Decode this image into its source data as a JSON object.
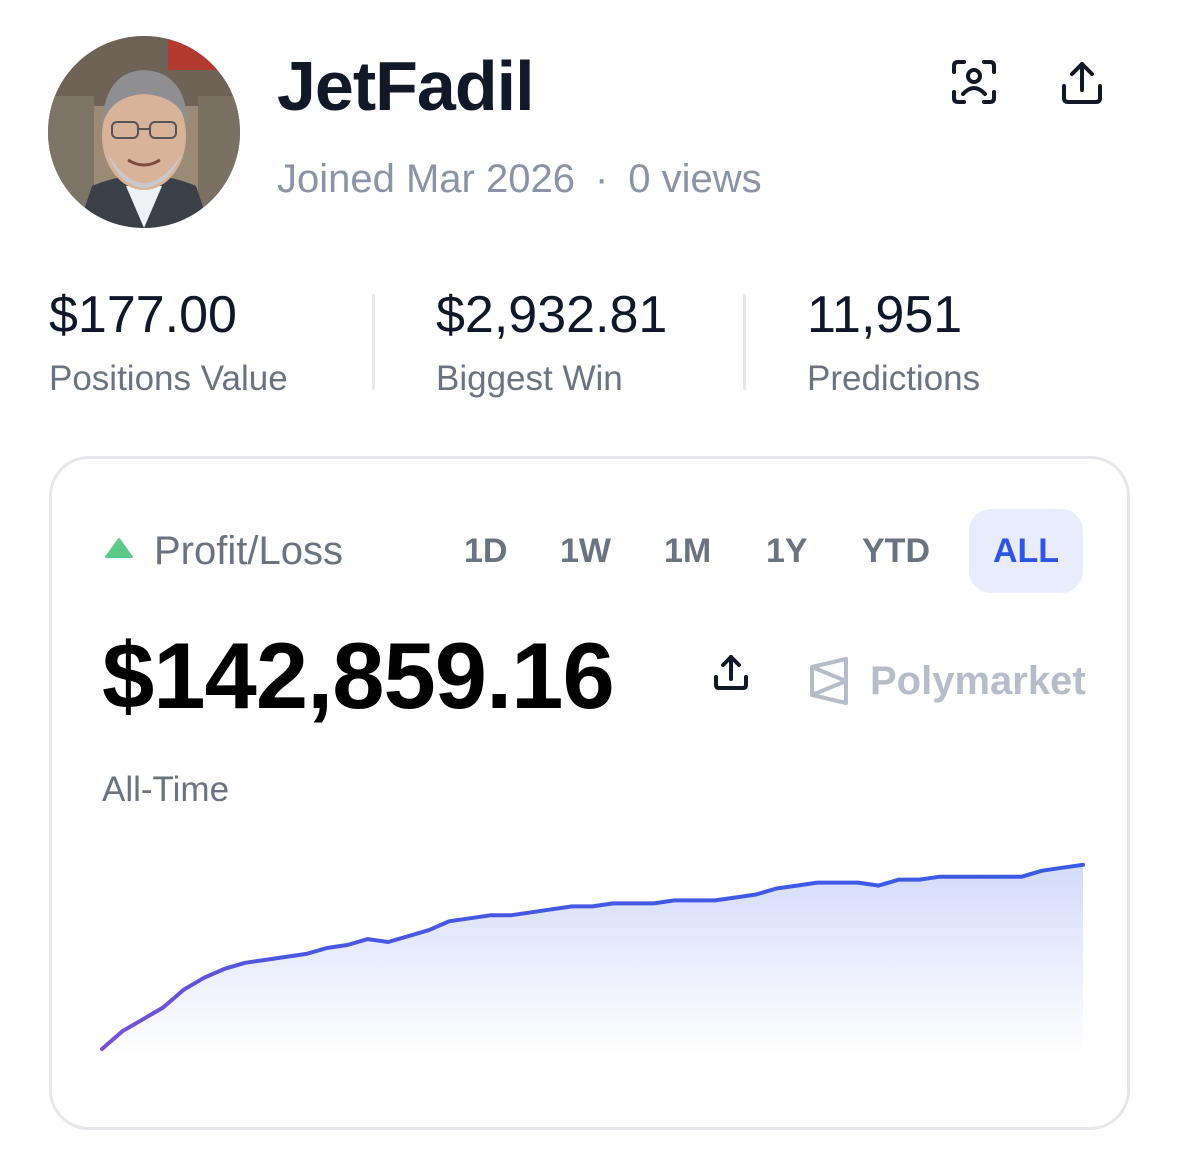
{
  "profile": {
    "username": "JetFadil",
    "joined": "Joined Mar 2026",
    "separator": "·",
    "views": "0 views",
    "avatar_icon": "user-photo-avatar"
  },
  "header_actions": {
    "scan_icon": "face-scan-icon",
    "share_icon": "share-upload-icon"
  },
  "stats": [
    {
      "value": "$177.00",
      "label": "Positions Value"
    },
    {
      "value": "$2,932.81",
      "label": "Biggest Win"
    },
    {
      "value": "11,951",
      "label": "Predictions"
    }
  ],
  "pnl": {
    "label": "Profit/Loss",
    "trend_color": "#5cc98a",
    "ranges": [
      "1D",
      "1W",
      "1M",
      "1Y",
      "YTD",
      "ALL"
    ],
    "active_range": "ALL",
    "amount": "$142,859.16",
    "brand": "Polymarket",
    "period": "All-Time"
  },
  "colors": {
    "accent": "#2f55e4",
    "line_start": "#7b4fd6",
    "line_end": "#3a5be6"
  },
  "chart_data": {
    "type": "area",
    "x": [
      0,
      1,
      2,
      3,
      4,
      5,
      6,
      7,
      8,
      9,
      10,
      11,
      12,
      13,
      14,
      15,
      16,
      17,
      18,
      19,
      20,
      21,
      22,
      23,
      24,
      25,
      26,
      27,
      28,
      29,
      30,
      31,
      32,
      33,
      34,
      35,
      36,
      37,
      38,
      39,
      40,
      41,
      42,
      43,
      44,
      45,
      46,
      47,
      48
    ],
    "y": [
      0,
      6,
      10,
      14,
      20,
      24,
      27,
      29,
      30,
      31,
      32,
      34,
      35,
      37,
      36,
      38,
      40,
      43,
      44,
      45,
      45,
      46,
      47,
      48,
      48,
      49,
      49,
      49,
      50,
      50,
      50,
      51,
      52,
      54,
      55,
      56,
      56,
      56,
      55,
      57,
      57,
      58,
      58,
      58,
      58,
      58,
      60,
      61,
      62
    ],
    "ylim": [
      0,
      70
    ],
    "grid": false,
    "title": "",
    "xlabel": "",
    "ylabel": ""
  }
}
